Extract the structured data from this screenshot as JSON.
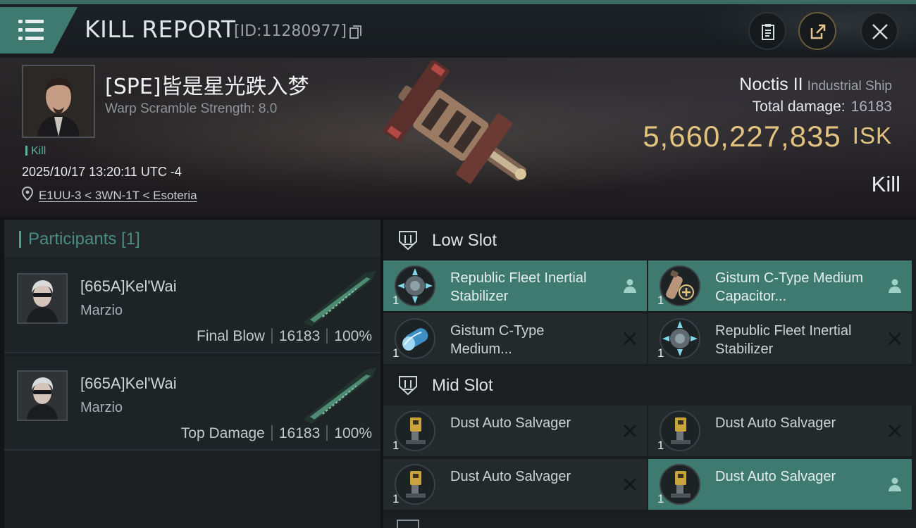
{
  "header": {
    "title": "KILL REPORT",
    "report_id": "[ID:11280977]",
    "icons": {
      "menu": "hamburger-menu-icon",
      "copy": "copy-icon",
      "clipboard": "clipboard-icon",
      "share": "share-icon",
      "close": "close-icon"
    }
  },
  "victim": {
    "pilot_name": "[SPE]皆是星光跌入梦",
    "warp_scramble": "Warp Scramble Strength: 8.0",
    "tag": "Kill",
    "datetime": "2025/10/17 13:20:11 UTC -4",
    "location": "E1UU-3 < 3WN-1T < Esoteria",
    "ship_name": "Noctis II",
    "ship_class": "Industrial Ship",
    "total_damage_label": "Total damage:",
    "total_damage": "16183",
    "isk_value": "5,660,227,835",
    "isk_unit": "ISK",
    "result": "Kill"
  },
  "participants": {
    "title": "Participants [1]",
    "rows": [
      {
        "name": "[665A]Kel'Wai",
        "corp": "Marzio",
        "role": "Final Blow",
        "damage": "16183",
        "percent": "100%"
      },
      {
        "name": "[665A]Kel'Wai",
        "corp": "Marzio",
        "role": "Top Damage",
        "damage": "16183",
        "percent": "100%"
      }
    ]
  },
  "fitting": {
    "low_slot": {
      "title": "Low Slot",
      "modules": [
        {
          "name": "Republic Fleet Inertial Stabilizer",
          "qty": "1",
          "status": "person",
          "active": true
        },
        {
          "name": "Gistum C-Type Medium Capacitor...",
          "qty": "1",
          "status": "person",
          "active": true
        },
        {
          "name": "Gistum C-Type Medium...",
          "qty": "1",
          "status": "destroyed",
          "active": false
        },
        {
          "name": "Republic Fleet Inertial Stabilizer",
          "qty": "1",
          "status": "destroyed",
          "active": false
        }
      ]
    },
    "mid_slot": {
      "title": "Mid Slot",
      "modules": [
        {
          "name": "Dust Auto Salvager",
          "qty": "1",
          "status": "destroyed",
          "active": false
        },
        {
          "name": "Dust Auto Salvager",
          "qty": "1",
          "status": "destroyed",
          "active": false
        },
        {
          "name": "Dust Auto Salvager",
          "qty": "1",
          "status": "destroyed",
          "active": false
        },
        {
          "name": "Dust Auto Salvager",
          "qty": "1",
          "status": "person",
          "active": true
        }
      ]
    }
  },
  "colors": {
    "accent": "#3f7a71",
    "isk": "#e2c27f",
    "panel": "#1e2326"
  }
}
